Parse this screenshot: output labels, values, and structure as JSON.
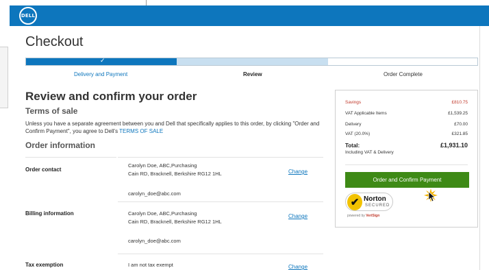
{
  "header": {
    "logo_text": "DELL",
    "brand_color": "#0d76bd"
  },
  "page": {
    "title": "Checkout"
  },
  "stepper": {
    "steps": [
      {
        "label": "Delivery and Payment",
        "state": "done",
        "icon": "check-icon"
      },
      {
        "label": "Review",
        "state": "current"
      },
      {
        "label": "Order Complete",
        "state": "pending"
      }
    ],
    "check_glyph": "✓"
  },
  "review": {
    "title": "Review and confirm your order",
    "terms_title": "Terms of sale",
    "terms_text": "Unless you have a separate agreement between you and Dell that specifically applies to this order, by clicking \"Order and Confirm Payment\", you agree to Dell's",
    "terms_link": "TERMS OF SALE",
    "order_info_title": "Order information"
  },
  "order_info": {
    "rows": [
      {
        "label": "Order contact",
        "line1": "Carolyn Doe, ABC,Purchasing",
        "line2": "Cain RD, Bracknell, Berkshire RG12 1HL",
        "email": "carolyn_doe@abc.com",
        "change": "Change"
      },
      {
        "label": "Billing information",
        "line1": "Carolyn Doe, ABC,Purchasing",
        "line2": "Cain RD, Bracknell, Berkshire RG12 1HL",
        "email": "carolyn_doe@abc.com",
        "change": "Change"
      },
      {
        "label": "Tax exemption",
        "line1": "I am not tax exempt",
        "change": "Change"
      }
    ]
  },
  "summary": {
    "savings_label": "Savings",
    "savings_value": "£810.75",
    "vat_items_label": "VAT Applicable Items",
    "vat_items_value": "£1,539.25",
    "delivery_label": "Delivery",
    "delivery_value": "£70.00",
    "vat_label": "VAT (20.0%)",
    "vat_value": "£321.85",
    "total_label": "Total:",
    "total_value": "£1,931.10",
    "total_sub": "Including VAT & Delivery",
    "confirm_button": "Order and Confirm Payment",
    "button_color": "#3e8a16",
    "savings_color": "#c0392b"
  },
  "norton": {
    "check_glyph": "✔",
    "name": "Norton",
    "secured": "SECURED",
    "powered_prefix": "powered by",
    "powered_brand": "VeriSign"
  }
}
